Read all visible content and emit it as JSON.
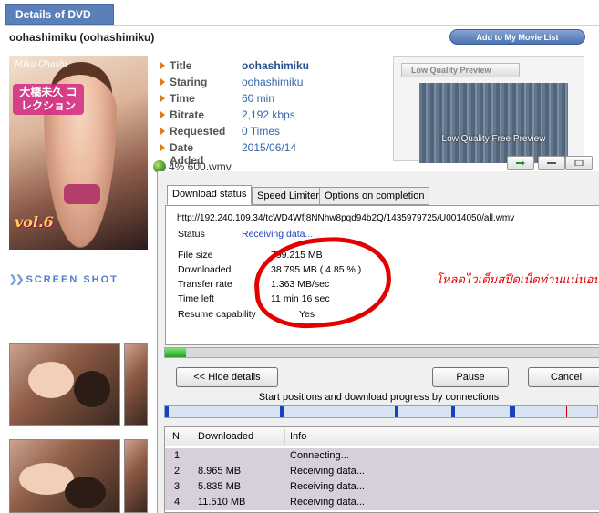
{
  "header": {
    "tab_label": "Details of DVD",
    "dvd_title": "oohashimiku (oohashimiku)",
    "add_button": "Add to My Movie List"
  },
  "cover": {
    "signature": "Miku Ohashi",
    "jp_title": "大橋未久 コレクション",
    "volume": "vol.6"
  },
  "details": [
    {
      "label": "Title",
      "value": "oohashimiku"
    },
    {
      "label": "Staring",
      "value": "oohashimiku"
    },
    {
      "label": "Time",
      "value": "60 min"
    },
    {
      "label": "Bitrate",
      "value": "2,192 kbps"
    },
    {
      "label": "Requested",
      "value": "0 Times"
    },
    {
      "label": "Date Added",
      "value": "2015/06/14"
    }
  ],
  "preview": {
    "header": "Low Quality Preview",
    "label": "Low Quality Free Preview"
  },
  "file_line": "4% 600.wmv",
  "screen_shot": "SCREEN SHOT",
  "dialog": {
    "tabs": [
      "Download status",
      "Speed Limiter",
      "Options on completion"
    ],
    "url": "http://192.240.109.34/tcWD4Wfj8NNhw8pqd94b2Q/1435979725/U0014050/all.wmv",
    "status_label": "Status",
    "status_value": "Receiving data...",
    "stats": [
      {
        "label": "File size",
        "value": "799.215  MB"
      },
      {
        "label": "Downloaded",
        "value": "38.795  MB  ( 4.85 % )"
      },
      {
        "label": "Transfer rate",
        "value": "1.363  MB/sec"
      },
      {
        "label": "Time left",
        "value": "11 min 16 sec"
      },
      {
        "label": "Resume capability",
        "value": "Yes"
      }
    ],
    "annotation": "โหลดไวเต็มสปีดเน็ตท่านแน่นอน",
    "progress": 0.0485,
    "hide_details_button": "<< Hide details",
    "pause_button": "Pause",
    "cancel_button": "Cancel",
    "connections_caption": "Start positions and download progress by connections",
    "columns": [
      "N.",
      "Downloaded",
      "Info"
    ],
    "rows": [
      {
        "n": "1",
        "downloaded": "",
        "info": "Connecting..."
      },
      {
        "n": "2",
        "downloaded": "8.965  MB",
        "info": "Receiving data..."
      },
      {
        "n": "3",
        "downloaded": "5.835  MB",
        "info": "Receiving data..."
      },
      {
        "n": "4",
        "downloaded": "11.510  MB",
        "info": "Receiving data..."
      }
    ]
  }
}
